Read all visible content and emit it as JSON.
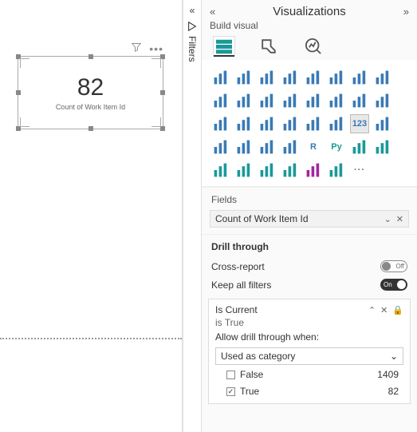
{
  "canvas": {
    "card_value": "82",
    "card_label": "Count of Work Item Id"
  },
  "filters_tab": {
    "label": "Filters"
  },
  "viz": {
    "title": "Visualizations",
    "subtitle": "Build visual",
    "gallery": [
      {
        "n": "stacked-bar-icon"
      },
      {
        "n": "stacked-column-icon"
      },
      {
        "n": "clustered-bar-icon"
      },
      {
        "n": "clustered-column-icon"
      },
      {
        "n": "100pct-bar-icon"
      },
      {
        "n": "100pct-column-icon"
      },
      {
        "n": "line-chart-icon"
      },
      {
        "n": "area-chart-icon"
      },
      {
        "n": "stacked-area-icon"
      },
      {
        "n": "line-stacked-column-icon"
      },
      {
        "n": "line-clustered-column-icon"
      },
      {
        "n": "ribbon-chart-icon"
      },
      {
        "n": "waterfall-icon"
      },
      {
        "n": "funnel-icon"
      },
      {
        "n": "scatter-icon"
      },
      {
        "n": "pie-chart-icon"
      },
      {
        "n": "donut-chart-icon"
      },
      {
        "n": "treemap-icon"
      },
      {
        "n": "map-icon"
      },
      {
        "n": "filled-map-icon"
      },
      {
        "n": "azure-map-icon"
      },
      {
        "n": "gauge-icon"
      },
      {
        "n": "card-icon",
        "sel": true,
        "txt": "123"
      },
      {
        "n": "multi-row-card-icon"
      },
      {
        "n": "kpi-icon"
      },
      {
        "n": "slicer-icon"
      },
      {
        "n": "table-icon"
      },
      {
        "n": "matrix-icon"
      },
      {
        "n": "r-visual-icon",
        "txt": "R"
      },
      {
        "n": "py-visual-icon",
        "txt": "Py",
        "cls": "teal"
      },
      {
        "n": "key-influencers-icon",
        "cls": "teal"
      },
      {
        "n": "decomposition-tree-icon",
        "cls": "teal"
      },
      {
        "n": "qa-icon",
        "cls": "teal"
      },
      {
        "n": "narrative-icon",
        "cls": "teal"
      },
      {
        "n": "goals-icon",
        "cls": "teal"
      },
      {
        "n": "paginated-icon",
        "cls": "teal"
      },
      {
        "n": "power-apps-icon",
        "cls": "purple"
      },
      {
        "n": "power-automate-icon",
        "cls": "teal"
      },
      {
        "n": "more-visuals-icon",
        "cls": "more",
        "txt": "···"
      }
    ],
    "fields_label": "Fields",
    "field_value": "Count of Work Item Id",
    "drill_label": "Drill through",
    "cross_report_label": "Cross-report",
    "cross_report_state": "Off",
    "keep_filters_label": "Keep all filters",
    "keep_filters_state": "On",
    "drill_field": "Is Current",
    "drill_summary": "is True",
    "drill_help": "Allow drill through when:",
    "drill_mode": "Used as category",
    "values": [
      {
        "label": "False",
        "count": "1409",
        "checked": false
      },
      {
        "label": "True",
        "count": "82",
        "checked": true
      }
    ]
  }
}
